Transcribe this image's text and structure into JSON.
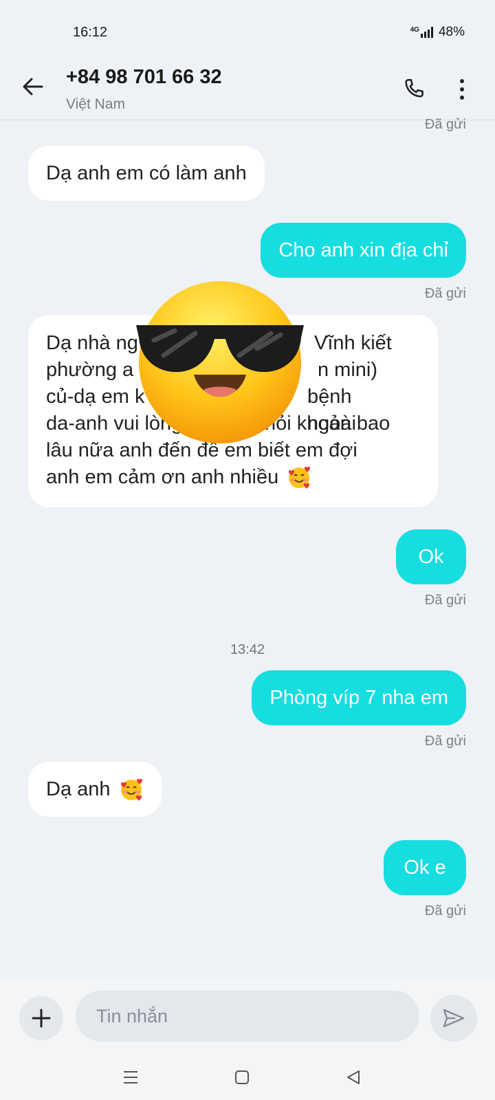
{
  "status_bar": {
    "time": "16:12",
    "network": "4G",
    "battery": "48%"
  },
  "header": {
    "contact_number": "+84 98 701 66 32",
    "contact_country": "Việt Nam",
    "icons": [
      "back-arrow-icon",
      "phone-icon",
      "more-vert-icon"
    ]
  },
  "conversation": {
    "top_status": "Đã gửi",
    "messages": [
      {
        "direction": "incoming",
        "text": "Dạ anh em có làm anh"
      },
      {
        "direction": "outgoing",
        "text": "Cho anh xin địa chỉ",
        "status": "Đã gửi"
      },
      {
        "direction": "incoming",
        "lines": [
          "Dạ nhà ng",
          "Vĩnh kiết",
          "phường a",
          "n mini)",
          "củ-dạ em k",
          "bệnh ngoài",
          "da-anh vui lòng",
          "hỏi khoản bao",
          "lâu nữa anh đến để em biết em đợi",
          "anh em cảm ơn anh nhiều"
        ],
        "emoji": "smiling-face-with-hearts"
      },
      {
        "direction": "outgoing",
        "text": "Ok",
        "status": "Đã gửi"
      },
      {
        "divider": true,
        "time": "13:42"
      },
      {
        "direction": "outgoing",
        "text": "Phòng víp 7 nha em",
        "status": "Đã gửi"
      },
      {
        "direction": "incoming",
        "text": "Dạ anh",
        "emoji": "smiling-face-with-hearts"
      },
      {
        "direction": "outgoing",
        "text": "Ok e",
        "status": "Đã gửi"
      }
    ],
    "overlay_sticker": "smiling-face-with-sunglasses"
  },
  "composer": {
    "placeholder": "Tin nhắn",
    "icons": [
      "plus-icon",
      "send-icon"
    ]
  },
  "nav_bar": {
    "icons": [
      "recents-icon",
      "home-icon",
      "back-triangle-icon"
    ]
  },
  "colors": {
    "outgoing_bubble": "#16dde0",
    "incoming_bubble": "#ffffff",
    "background": "#eef1f5"
  }
}
